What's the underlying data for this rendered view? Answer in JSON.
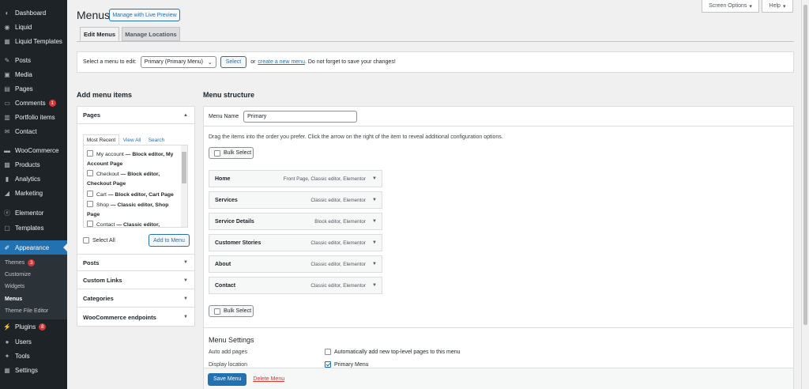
{
  "sidebar": {
    "items": [
      {
        "label": "Dashboard",
        "icon": "dashboard-icon",
        "glyph": "◐"
      },
      {
        "label": "Liquid",
        "icon": "liquid-icon",
        "glyph": "◉"
      },
      {
        "label": "Liquid Templates",
        "icon": "templates-icon",
        "glyph": "▦"
      },
      {
        "label": "Posts",
        "icon": "pin-icon",
        "glyph": "✎"
      },
      {
        "label": "Media",
        "icon": "media-icon",
        "glyph": "▣"
      },
      {
        "label": "Pages",
        "icon": "pages-icon",
        "glyph": "▤"
      },
      {
        "label": "Comments",
        "icon": "comments-icon",
        "glyph": "▭",
        "badge": "1"
      },
      {
        "label": "Portfolio items",
        "icon": "portfolio-icon",
        "glyph": "▥"
      },
      {
        "label": "Contact",
        "icon": "contact-icon",
        "glyph": "✉"
      },
      {
        "label": "WooCommerce",
        "icon": "woocommerce-icon",
        "glyph": "▬"
      },
      {
        "label": "Products",
        "icon": "products-icon",
        "glyph": "▩"
      },
      {
        "label": "Analytics",
        "icon": "analytics-icon",
        "glyph": "▮"
      },
      {
        "label": "Marketing",
        "icon": "megaphone-icon",
        "glyph": "◢"
      },
      {
        "label": "Elementor",
        "icon": "elementor-icon",
        "glyph": "ⓔ"
      },
      {
        "label": "Templates",
        "icon": "folder-icon",
        "glyph": "▢"
      },
      {
        "label": "Appearance",
        "icon": "brush-icon",
        "glyph": "✐"
      }
    ],
    "submenu": [
      {
        "label": "Themes",
        "badge": "3"
      },
      {
        "label": "Customize"
      },
      {
        "label": "Widgets"
      },
      {
        "label": "Menus"
      },
      {
        "label": "Theme File Editor"
      }
    ],
    "lower": [
      {
        "label": "Plugins",
        "icon": "plugins-icon",
        "glyph": "⚡",
        "badge": "8"
      },
      {
        "label": "Users",
        "icon": "users-icon",
        "glyph": "●"
      },
      {
        "label": "Tools",
        "icon": "tools-icon",
        "glyph": "✦"
      },
      {
        "label": "Settings",
        "icon": "settings-icon",
        "glyph": "▦"
      }
    ]
  },
  "header": {
    "title": "Menus",
    "live_preview": "Manage with Live Preview",
    "screen_options": "Screen Options",
    "help": "Help"
  },
  "tabs": [
    "Edit Menus",
    "Manage Locations"
  ],
  "select_bar": {
    "label": "Select a menu to edit:",
    "selected": "Primary (Primary Menu)",
    "select_button": "Select",
    "or": "or",
    "create_link": "create a new menu",
    "hint": ". Do not forget to save your changes!"
  },
  "add_items": {
    "title": "Add menu items",
    "sections": [
      "Pages",
      "Posts",
      "Custom Links",
      "Categories",
      "WooCommerce endpoints"
    ],
    "page_tabs": [
      "Most Recent",
      "View All",
      "Search"
    ],
    "pages": [
      {
        "title": "My account",
        "meta": "— Block editor, My Account Page"
      },
      {
        "title": "Checkout",
        "meta": "— Block editor, Checkout Page"
      },
      {
        "title": "Cart",
        "meta": "— Block editor, Cart Page"
      },
      {
        "title": "Shop",
        "meta": "— Classic editor, Shop Page"
      },
      {
        "title": "Contact",
        "meta": "— Classic editor,"
      }
    ],
    "select_all": "Select All",
    "add_button": "Add to Menu"
  },
  "structure": {
    "title": "Menu structure",
    "name_label": "Menu Name",
    "name_value": "Primary",
    "drag_hint": "Drag the items into the order you prefer. Click the arrow on the right of the item to reveal additional configuration options.",
    "bulk_select": "Bulk Select",
    "items": [
      {
        "label": "Home",
        "meta": "Front Page, Classic editor, Elementor"
      },
      {
        "label": "Services",
        "meta": "Classic editor, Elementor"
      },
      {
        "label": "Service Details",
        "meta": "Block editor, Elementor"
      },
      {
        "label": "Customer Stories",
        "meta": "Classic editor, Elementor"
      },
      {
        "label": "About",
        "meta": "Classic editor, Elementor"
      },
      {
        "label": "Contact",
        "meta": "Classic editor, Elementor"
      }
    ]
  },
  "settings": {
    "title": "Menu Settings",
    "auto_add_label": "Auto add pages",
    "auto_add_text": "Automatically add new top-level pages to this menu",
    "display_label": "Display location",
    "display_value": "Primary Menu"
  },
  "footer": {
    "save": "Save Menu",
    "delete": "Delete Menu"
  },
  "colors": {
    "sidebar_bg": "#1d2327",
    "accent": "#2271b1",
    "danger": "#d63638"
  }
}
